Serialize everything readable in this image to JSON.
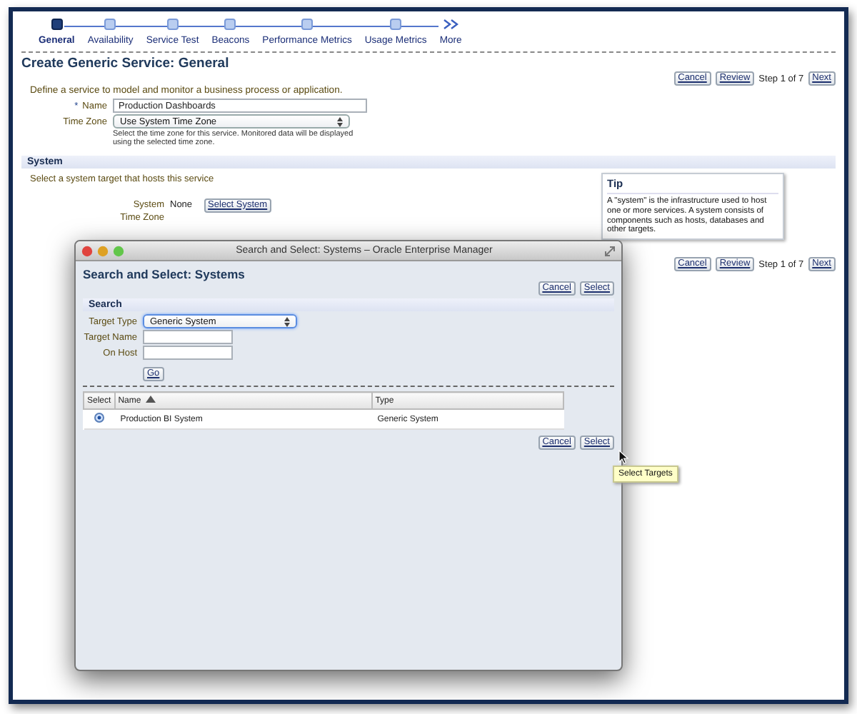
{
  "train": [
    {
      "label": "General",
      "kind": "step",
      "selected": true
    },
    {
      "label": "Availability",
      "kind": "step",
      "selected": false
    },
    {
      "label": "Service Test",
      "kind": "step",
      "selected": false
    },
    {
      "label": "Beacons",
      "kind": "step",
      "selected": false
    },
    {
      "label": "Performance Metrics",
      "kind": "step",
      "selected": false
    },
    {
      "label": "Usage Metrics",
      "kind": "step",
      "selected": false
    },
    {
      "label": "More",
      "kind": "more",
      "selected": false
    }
  ],
  "page": {
    "title": "Create Generic Service: General",
    "toolbar": [
      {
        "kind": "button",
        "label": "Cancel"
      },
      {
        "kind": "button",
        "label": "Review"
      },
      {
        "kind": "text",
        "label": "Step 1 of 7"
      },
      {
        "kind": "button",
        "label": "Next"
      }
    ],
    "description": "Define a service to model and monitor a business process or application.",
    "fields": [
      {
        "label": "Name",
        "marker": "*",
        "kind": "text",
        "value": "Production Dashboards"
      },
      {
        "label": "Time Zone",
        "kind": "select",
        "value": "Use System Time Zone",
        "hint": "Select the time zone for this service. Monitored data will be displayed using the selected time zone."
      }
    ]
  },
  "system": {
    "title": "System",
    "instruction": "Select a system target that hosts this service",
    "fields": [
      {
        "label": "System",
        "value": "None",
        "button": "Select System"
      },
      {
        "label": "Time Zone"
      }
    ],
    "tip": {
      "title": "Tip",
      "text": "A \"system\" is the infrastructure used to host one or more services. A system consists of components such as hosts, databases and other targets."
    }
  },
  "bottom_toolbar": [
    {
      "kind": "button",
      "label": "Cancel"
    },
    {
      "kind": "button",
      "label": "Review"
    },
    {
      "kind": "text",
      "label": "Step 1 of 7"
    },
    {
      "kind": "button",
      "label": "Next"
    }
  ],
  "dialog": {
    "window_title": "Search and Select: Systems – Oracle Enterprise Manager",
    "title": "Search and Select: Systems",
    "buttons": [
      "Cancel",
      "Select"
    ],
    "search": {
      "title": "Search",
      "fields": [
        {
          "label": "Target Type",
          "kind": "select",
          "value": "Generic System"
        },
        {
          "label": "Target Name",
          "kind": "text"
        },
        {
          "label": "On Host",
          "kind": "text"
        }
      ],
      "go": "Go"
    },
    "table": {
      "columns": [
        {
          "label": "Select",
          "sorted": false
        },
        {
          "label": "Name",
          "sorted": true
        },
        {
          "label": "Type",
          "sorted": false
        }
      ],
      "rows": [
        {
          "selected": true,
          "name": "Production BI System",
          "type": "Generic System"
        }
      ]
    },
    "bottom_buttons": [
      "Cancel",
      "Select"
    ],
    "tooltip": "Select Targets"
  }
}
